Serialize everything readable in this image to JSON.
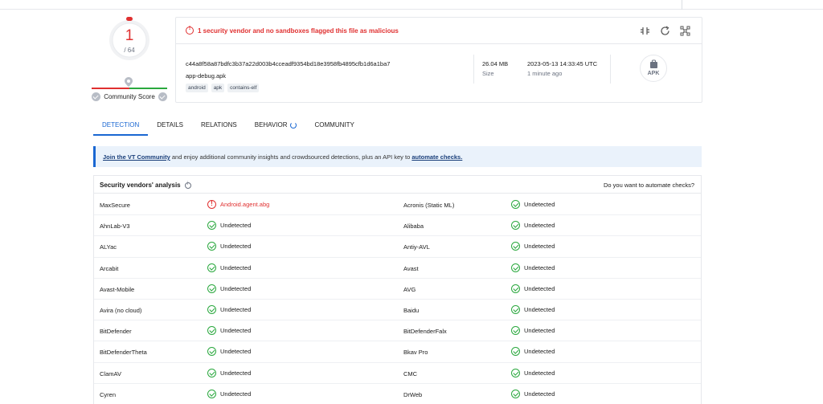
{
  "score": {
    "detections": "1",
    "total": "/ 64",
    "community_label": "Community Score"
  },
  "summary": {
    "alert": "1 security vendor and no sandboxes flagged this file as malicious",
    "hash": "c44a8f58a87bdfc3b37a22d003b4cceadf9354bd18e3958fb4895cfb1d6a1ba7",
    "filename": "app-debug.apk",
    "tags": [
      "android",
      "apk",
      "contains-elf"
    ],
    "size_value": "26.04 MB",
    "size_label": "Size",
    "date_value": "2023-05-13 14:33:45 UTC",
    "date_label": "1 minute ago",
    "filetype": "APK",
    "tool_icons": [
      "compare-icon",
      "reanalyze-icon",
      "graph-icon"
    ]
  },
  "tabs": [
    {
      "label": "DETECTION",
      "active": true
    },
    {
      "label": "DETAILS",
      "active": false
    },
    {
      "label": "RELATIONS",
      "active": false
    },
    {
      "label": "BEHAVIOR",
      "active": false
    },
    {
      "label": "COMMUNITY",
      "active": false
    }
  ],
  "banner": {
    "link1": "Join the VT Community",
    "middle": " and enjoy additional community insights and crowdsourced detections, plus an API key to ",
    "link2": "automate checks."
  },
  "analysis": {
    "title": "Security vendors' analysis",
    "automate": "Do you want to automate checks?",
    "rows": [
      {
        "v1": "MaxSecure",
        "r1": "Android.agent.abg",
        "m1": true,
        "v2": "Acronis (Static ML)",
        "r2": "Undetected",
        "m2": false
      },
      {
        "v1": "AhnLab-V3",
        "r1": "Undetected",
        "m1": false,
        "v2": "Alibaba",
        "r2": "Undetected",
        "m2": false
      },
      {
        "v1": "ALYac",
        "r1": "Undetected",
        "m1": false,
        "v2": "Antiy-AVL",
        "r2": "Undetected",
        "m2": false
      },
      {
        "v1": "Arcabit",
        "r1": "Undetected",
        "m1": false,
        "v2": "Avast",
        "r2": "Undetected",
        "m2": false
      },
      {
        "v1": "Avast-Mobile",
        "r1": "Undetected",
        "m1": false,
        "v2": "AVG",
        "r2": "Undetected",
        "m2": false
      },
      {
        "v1": "Avira (no cloud)",
        "r1": "Undetected",
        "m1": false,
        "v2": "Baidu",
        "r2": "Undetected",
        "m2": false
      },
      {
        "v1": "BitDefender",
        "r1": "Undetected",
        "m1": false,
        "v2": "BitDefenderFalx",
        "r2": "Undetected",
        "m2": false
      },
      {
        "v1": "BitDefenderTheta",
        "r1": "Undetected",
        "m1": false,
        "v2": "Bkav Pro",
        "r2": "Undetected",
        "m2": false
      },
      {
        "v1": "ClamAV",
        "r1": "Undetected",
        "m1": false,
        "v2": "CMC",
        "r2": "Undetected",
        "m2": false
      },
      {
        "v1": "Cyren",
        "r1": "Undetected",
        "m1": false,
        "v2": "DrWeb",
        "r2": "Undetected",
        "m2": false
      }
    ]
  },
  "colors": {
    "malicious": "#e03030",
    "clean": "#2aa83e",
    "accent": "#1a67d2"
  }
}
